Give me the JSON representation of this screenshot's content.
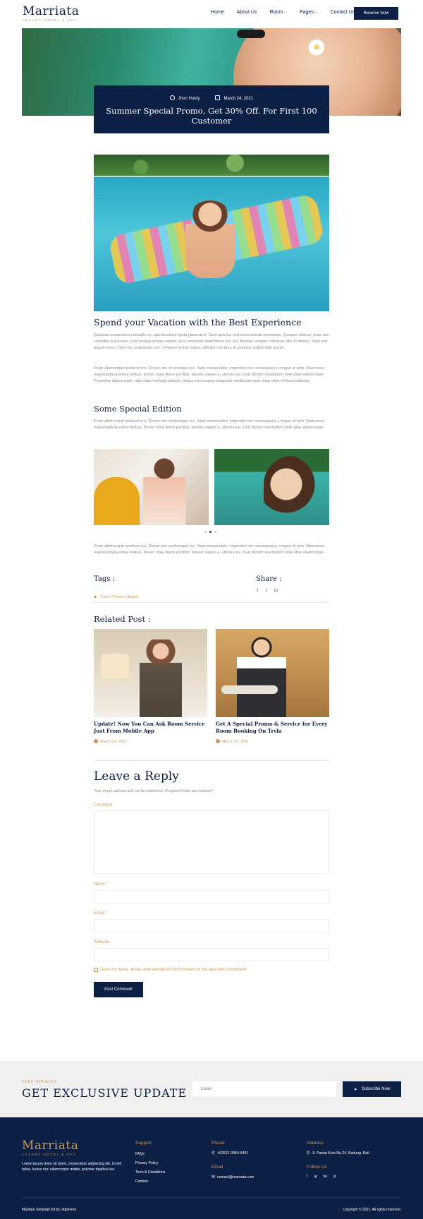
{
  "header": {
    "logo_title": "Marriata",
    "logo_sub": "LUXURY HOTEL & SPA",
    "nav": [
      {
        "label": "Home",
        "dropdown": false
      },
      {
        "label": "About Us",
        "dropdown": false
      },
      {
        "label": "Room",
        "dropdown": true
      },
      {
        "label": "Pages",
        "dropdown": true
      },
      {
        "label": "Contact Us",
        "dropdown": false
      }
    ],
    "reserve_label": "Reserve Now"
  },
  "post": {
    "author": "Jhon Hurdy",
    "date": "March 24, 2021",
    "title": "Summer Special Promo, Get 30% Off. For First 100 Customer",
    "section1_title": "Spend your Vacation with the Best Experience",
    "section1_p1": "Quisque consectetur convallis ex, quis tincidunt ligula placerat et. Nam quis leo sed tortor blandit commodo. Quisque ultrices, justo non convallis accumsan, ante magna ornare sapien, quis venenatis diam libero nec est. Aenean semper interdum odio in dictum. Nam sed augue lorem. Duis nec sollicitudin orci. Vivamus lectus metus, efficitur non arcu id, pulvinar sollicit odin ipsum.",
    "section1_p2": "Proin ullamcorper pretium orci. Donec nec scelerisque leo. Nam massa dolor, imperdiet nec consequat a, congue id sem. Maecenas malesuada faucibus finibus. Donec vitae libero porttitor, laoreet sapien a, ultrices leo. Duis dictum vestibulum ante vitae ullamcorper. Phasellus ullamcorper, odio vitae eleifend ultricies, lectus orci congue magna in vestibulum ante vitae vitae eleifend ultricies.",
    "section2_title": "Some Special Edition",
    "section2_p1": "Proin ullamcorper pretium orci. Donec nec scelerisque leo. Nam massa dolor, imperdiet nec consequat a, congue id sem. Maecenas malesuada faucibus finibus. Donec vitae libero porttitor, laoreet sapien a, ultrices leo. Duis dictum vestibulum ante vitae ullamcorper.",
    "section2_p2": "Proin ullamcorper pretium orci. Donec nec scelerisque leo. Nam massa dolor, imperdiet nec consequat a, congue id sem. Maecenas malesuada faucibus finibus. Donec vitae libero porttitor, laoreet sapien a, ultrices leo. Duis dictum vestibulum ante vitae ullamcorper.",
    "tags_label": "Tags :",
    "tags": "Travel, Promo, Update",
    "share_label": "Share :",
    "share_icons": [
      "f",
      "t",
      "in"
    ]
  },
  "related": {
    "heading": "Related Post :",
    "items": [
      {
        "title": "Update! Now You Can Ask Room Service Just From Mobile App",
        "date": "March 24, 2021"
      },
      {
        "title": "Get A Special Promo & Service for Every Room Booking On Trvla",
        "date": "March 24, 2021"
      }
    ]
  },
  "reply": {
    "heading": "Leave a Reply",
    "note": "Your email address will not be published. Required fields are marked *",
    "comment_label": "Comment",
    "name_label": "Name *",
    "email_label": "Email *",
    "website_label": "Website",
    "save_label": "Save my name, email, and website in this browser for the next time I comment.",
    "submit_label": "Post Comment"
  },
  "newsletter": {
    "kicker": "KEEP UPDATED",
    "heading": "GET EXCLUSIVE UPDATE",
    "email_placeholder": "Email",
    "button_label": "Subscribe Now"
  },
  "footer": {
    "logo_title": "Marriata",
    "logo_sub": "LUXURY HOTEL & SPA",
    "about": "Lorem ipsum dolor sit amet, consectetur adipiscing elit. Ut elit tellus, luctus nec ullamcorper mattis, pulvinar dapibus leo.",
    "support_heading": "Support",
    "support_links": [
      "FAQs",
      "Privacy Policy",
      "Term & Conditions",
      "Contact"
    ],
    "phone_heading": "Phone",
    "phone": "+62621-3964-5491",
    "email_heading": "Email",
    "email": "contact@marriata.com",
    "address_heading": "Address",
    "address": "Jl. Pantai Kuta No.24, Badung, Bali.",
    "follow_heading": "Follow Us",
    "follow_icons": [
      "f",
      "ig",
      "tw",
      "yt"
    ],
    "credit": "Marriata Template Kit by Jegtheme",
    "copyright": "Copyright © 2021. All rights reserved."
  },
  "colors": {
    "navy": "#0c1f45",
    "gold": "#c89a5e"
  }
}
